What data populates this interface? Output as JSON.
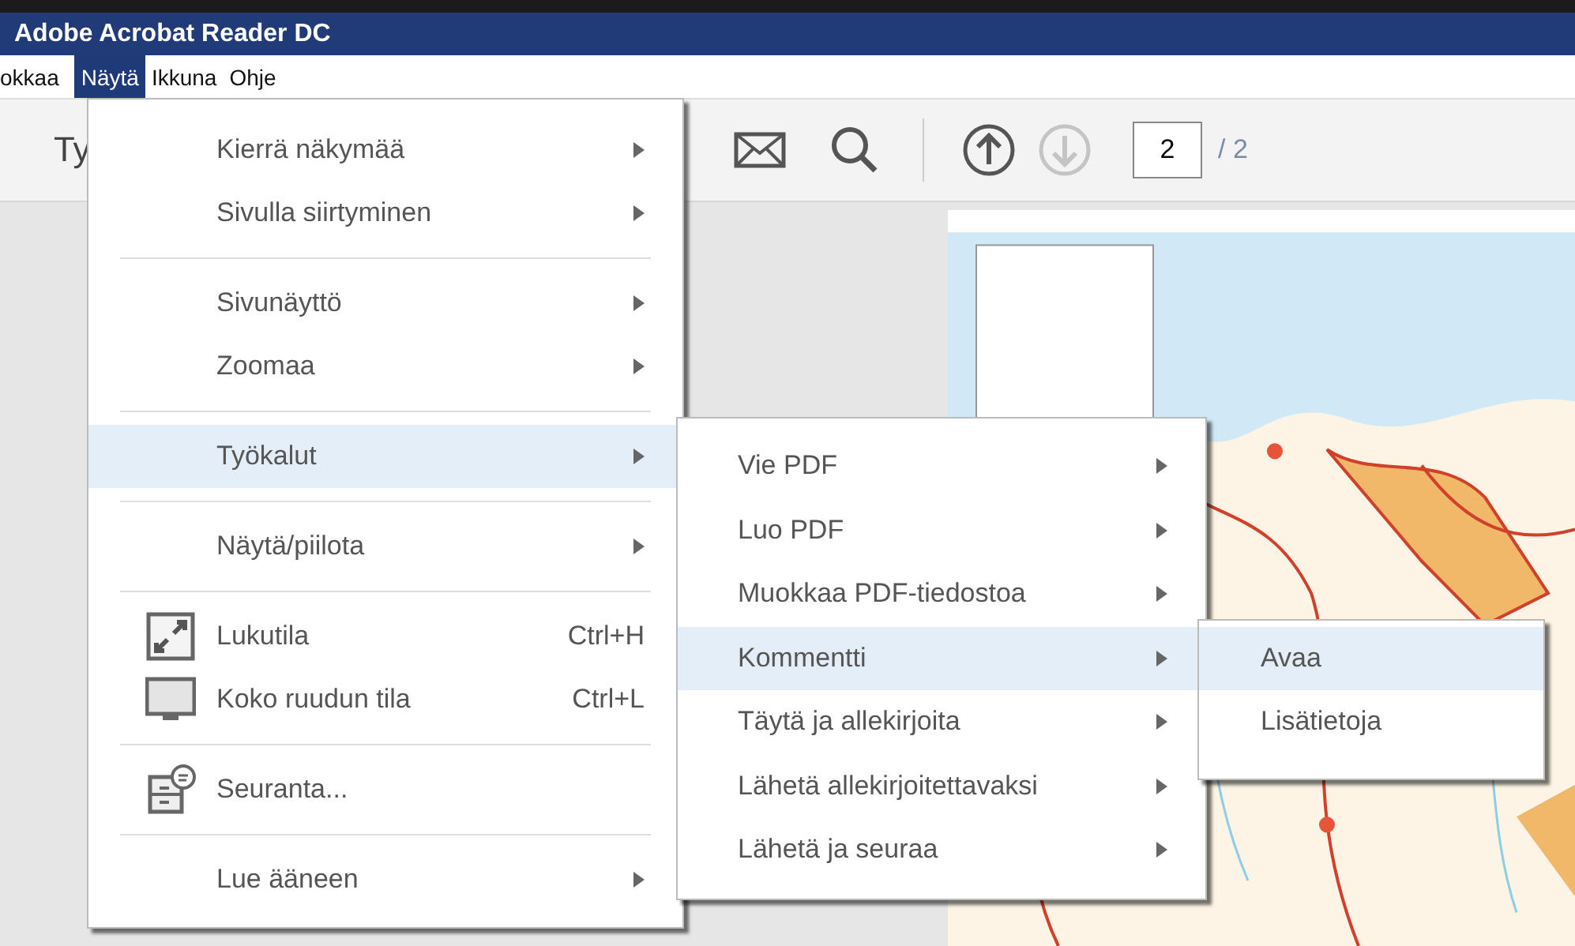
{
  "window": {
    "title": "Adobe Acrobat Reader DC"
  },
  "menubar": [
    {
      "label": "okkaa",
      "selected": false
    },
    {
      "label": "Näytä",
      "selected": true
    },
    {
      "label": "Ikkuna",
      "selected": false
    },
    {
      "label": "Ohje",
      "selected": false
    }
  ],
  "toolbar": {
    "tab_label": "Ty",
    "nav": [
      {
        "kind": "up",
        "disabled": false
      },
      {
        "kind": "down",
        "disabled": true
      }
    ],
    "page_input": "2",
    "page_total": "/ 2"
  },
  "view_menu": {
    "items": [
      {
        "kind": "item",
        "label": "Kierrä näkymää",
        "submenu": true,
        "selected": false
      },
      {
        "kind": "item",
        "label": "Sivulla siirtyminen",
        "submenu": true,
        "selected": false
      },
      {
        "kind": "separator"
      },
      {
        "kind": "item",
        "label": "Sivunäyttö",
        "submenu": true,
        "selected": false
      },
      {
        "kind": "item",
        "label": "Zoomaa",
        "submenu": true,
        "selected": false
      },
      {
        "kind": "separator"
      },
      {
        "kind": "item",
        "label": "Työkalut",
        "submenu": true,
        "selected": true
      },
      {
        "kind": "separator"
      },
      {
        "kind": "item",
        "label": "Näytä/piilota",
        "submenu": true,
        "selected": false
      },
      {
        "kind": "separator"
      },
      {
        "kind": "item",
        "label": "Lukutila",
        "shortcut": "Ctrl+H",
        "submenu": false,
        "selected": false
      },
      {
        "kind": "item",
        "label": "Koko ruudun tila",
        "shortcut": "Ctrl+L",
        "submenu": false,
        "selected": false
      },
      {
        "kind": "separator"
      },
      {
        "kind": "item",
        "label": "Seuranta...",
        "submenu": false,
        "selected": false
      },
      {
        "kind": "separator"
      },
      {
        "kind": "item",
        "label": "Lue ääneen",
        "submenu": true,
        "selected": false
      }
    ]
  },
  "tools_menu": {
    "items": [
      {
        "kind": "item",
        "label": "Vie PDF",
        "submenu": true,
        "selected": false
      },
      {
        "kind": "item",
        "label": "Luo PDF",
        "submenu": true,
        "selected": false
      },
      {
        "kind": "item",
        "label": "Muokkaa PDF-tiedostoa",
        "submenu": true,
        "selected": false
      },
      {
        "kind": "item",
        "label": "Kommentti",
        "submenu": true,
        "selected": true
      },
      {
        "kind": "item",
        "label": "Täytä ja allekirjoita",
        "submenu": true,
        "selected": false
      },
      {
        "kind": "item",
        "label": "Lähetä allekirjoitettavaksi",
        "submenu": true,
        "selected": false
      },
      {
        "kind": "item",
        "label": "Lähetä ja seuraa",
        "submenu": true,
        "selected": false
      }
    ]
  },
  "comment_menu": {
    "items": [
      {
        "kind": "item",
        "label": "Avaa",
        "submenu": false,
        "selected": true
      },
      {
        "kind": "item",
        "label": "Lisätietoja",
        "submenu": false,
        "selected": false
      }
    ]
  }
}
